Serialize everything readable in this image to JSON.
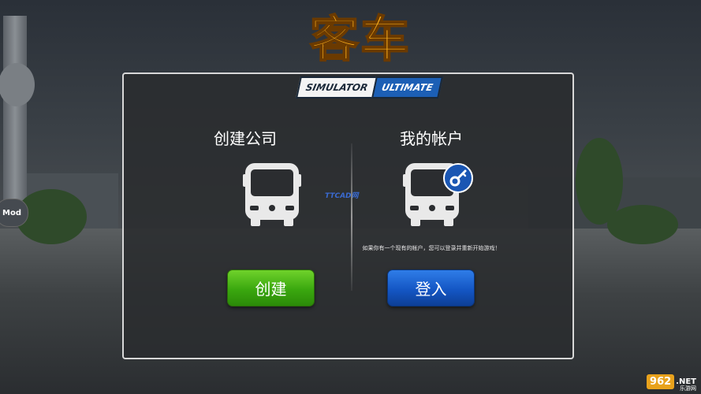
{
  "logo": {
    "title_cn": "客车",
    "badge_left": "SIMULATOR",
    "badge_right": "ULTIMATE"
  },
  "side": {
    "mod_label": "Mod"
  },
  "dialog": {
    "left": {
      "title": "创建公司",
      "button_label": "创建",
      "icon": "bus-front-icon"
    },
    "right": {
      "title": "我的帐户",
      "hint": "如果你有一个现有的帐户，您可以登录并重新开始游戏！",
      "button_label": "登入",
      "icon": "bus-front-icon",
      "badge_icon": "key-icon"
    },
    "center_watermark": "TTCAD网"
  },
  "watermark": {
    "number": "962",
    "suffix": ".NET",
    "sub": "乐游网"
  },
  "colors": {
    "create_button": "#3aa70f",
    "login_button": "#1456c4",
    "logo_orange": "#ffb21e"
  }
}
